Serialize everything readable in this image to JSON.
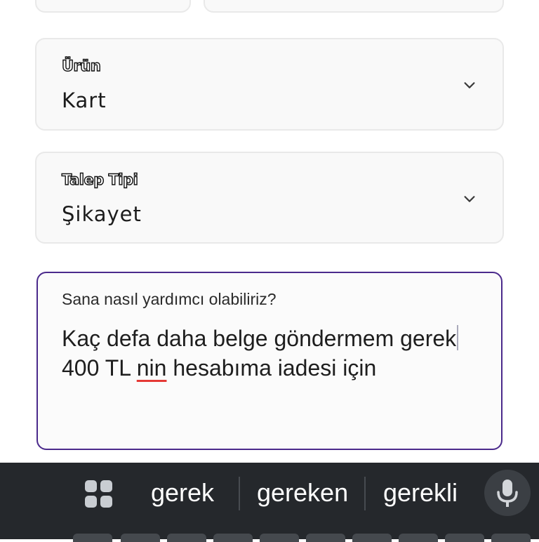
{
  "form": {
    "product": {
      "label": "Ürün",
      "value": "Kart"
    },
    "request_type": {
      "label": "Talep Tipi",
      "value": "Şikayet"
    },
    "message": {
      "label": "Sana nasıl yardımcı olabiliriz?",
      "text_before_cursor": "Kaç defa daha belge göndermem gerek",
      "text_after_cursor": " 400 TL ",
      "misspelled_word": "nin",
      "text_end": " hesabıma iadesi için"
    }
  },
  "keyboard": {
    "suggestions": [
      "gerek",
      "gereken",
      "gerekli"
    ],
    "icons": {
      "menu": "apps-grid-icon",
      "voice": "microphone-icon"
    }
  },
  "colors": {
    "accent": "#4b2a8c",
    "keyboard_bg": "#25282c",
    "error_underline": "#e53935"
  }
}
